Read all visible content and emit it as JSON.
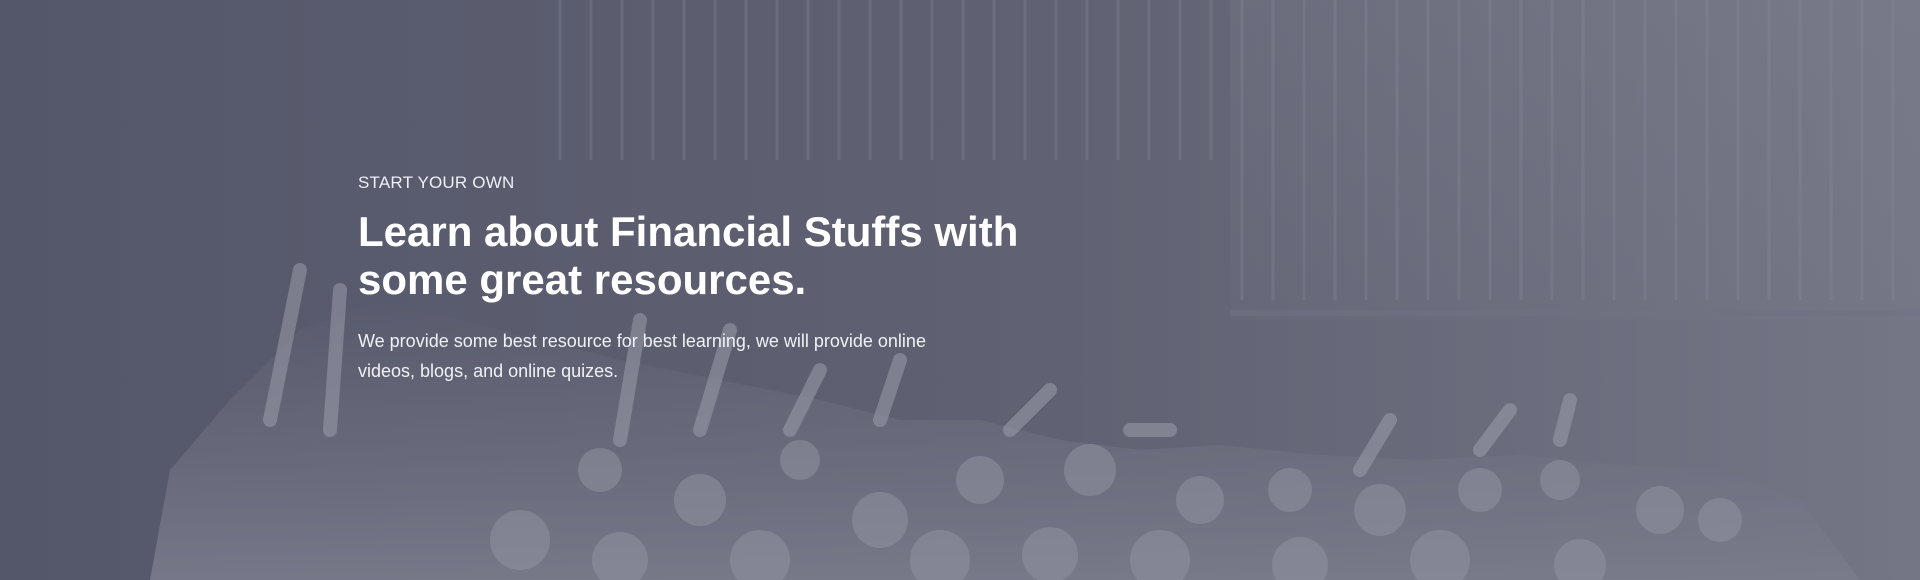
{
  "hero": {
    "eyebrow": "START YOUR OWN",
    "headline": "Learn about Financial Stuffs with some great resources.",
    "description": "We provide some best resource for best learning, we will provide online videos, blogs, and online quizes.",
    "background_image": "concert-crowd-raised-hands-photo",
    "overlay_color": "#5f6172"
  }
}
